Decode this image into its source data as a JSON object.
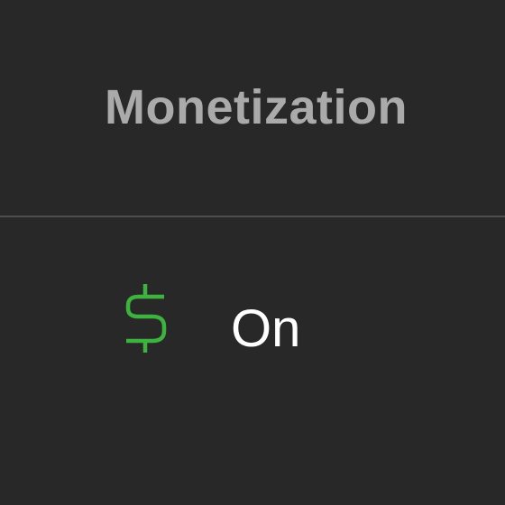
{
  "column": {
    "header_label": "Monetization"
  },
  "row": {
    "status_icon": "dollar-icon",
    "status_text": "On",
    "status_color": "#3cb33c"
  },
  "colors": {
    "background": "#282828",
    "header_text": "#aaaaaa",
    "divider": "#4d4d4d",
    "value_text": "#ffffff"
  }
}
